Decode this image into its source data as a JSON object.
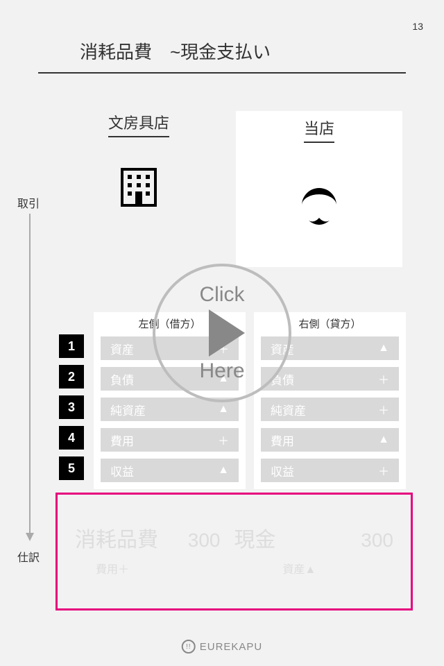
{
  "page_number": "13",
  "title": "消耗品費　~現金支払い",
  "side_labels": {
    "transaction": "取引",
    "journal": "仕訳"
  },
  "entities": {
    "left": "文房具店",
    "right": "当店"
  },
  "columns": {
    "left_header": "左側（借方）",
    "right_header": "右側（貸方）"
  },
  "rows": [
    "1",
    "2",
    "3",
    "4",
    "5"
  ],
  "categories": {
    "left": [
      {
        "label": "資産",
        "sym": "＋"
      },
      {
        "label": "負債",
        "sym": "▲"
      },
      {
        "label": "純資産",
        "sym": "▲"
      },
      {
        "label": "費用",
        "sym": "＋"
      },
      {
        "label": "収益",
        "sym": "▲"
      }
    ],
    "right": [
      {
        "label": "資産",
        "sym": "▲"
      },
      {
        "label": "負債",
        "sym": "＋"
      },
      {
        "label": "純資産",
        "sym": "＋"
      },
      {
        "label": "費用",
        "sym": "▲"
      },
      {
        "label": "収益",
        "sym": "＋"
      }
    ]
  },
  "journal": {
    "debit_label": "消耗品費",
    "debit_amount": "300",
    "debit_sub": "費用＋",
    "credit_label": "現金",
    "credit_amount": "300",
    "credit_sub": "資産▲"
  },
  "play": {
    "click": "Click",
    "here": "Here"
  },
  "footer": {
    "brand": "EUREKAPU",
    "mark": "!!"
  }
}
